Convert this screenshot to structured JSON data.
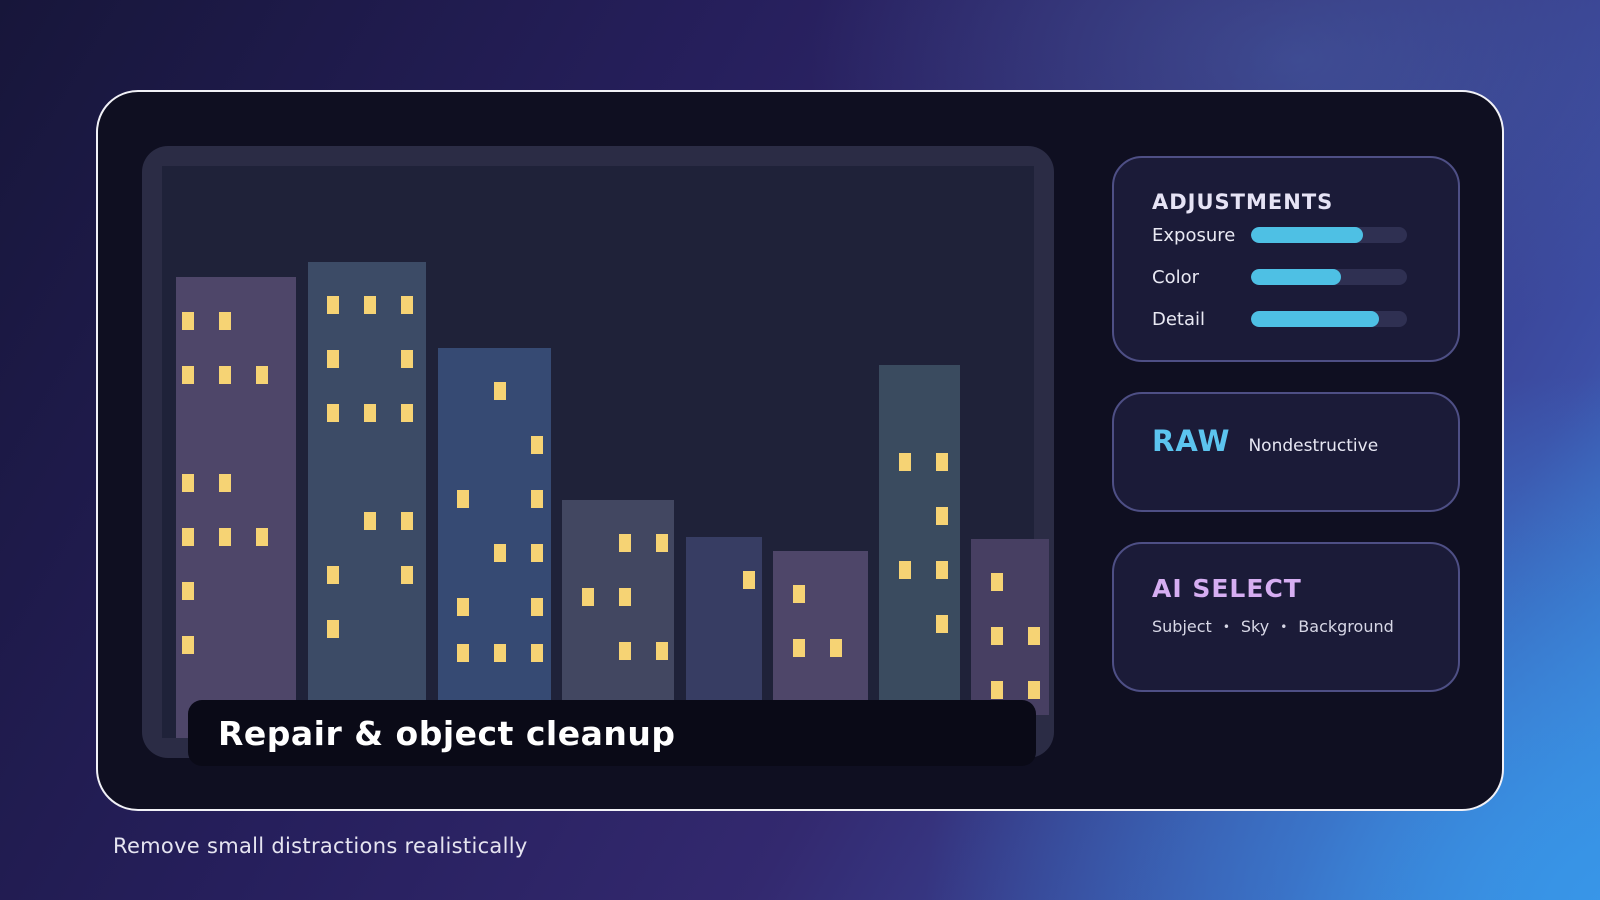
{
  "preview": {
    "caption": "Repair & object cleanup"
  },
  "adjustments": {
    "title": "ADJUSTMENTS",
    "sliders": [
      {
        "label": "Exposure",
        "value": 0.72
      },
      {
        "label": "Color",
        "value": 0.58
      },
      {
        "label": "Detail",
        "value": 0.82
      }
    ],
    "accent": "#4ec0e4"
  },
  "raw": {
    "title": "RAW",
    "subtitle": "Nondestructive",
    "accent": "#5cc4ef"
  },
  "ai_select": {
    "title": "AI SELECT",
    "tags": [
      "Subject",
      "Sky",
      "Background"
    ],
    "separator": "•",
    "accent": "#d6aef2"
  },
  "footer": {
    "subtitle": "Remove small distractions realistically"
  },
  "colors": {
    "window_light": "#f6d374",
    "building_purple": "#4e4669",
    "building_slate": "#3c4b66",
    "building_blue": "#364a73"
  }
}
